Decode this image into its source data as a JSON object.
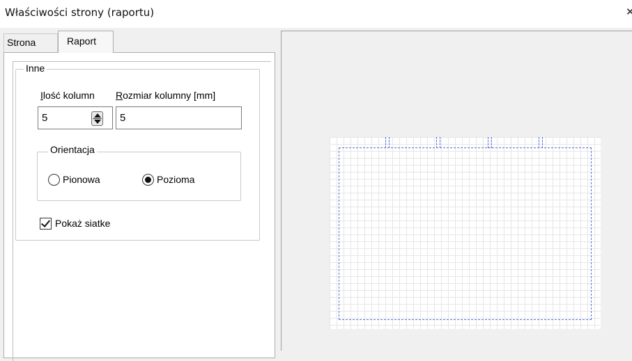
{
  "window": {
    "title": "Właściwości strony (raportu)",
    "close_glyph": "✕"
  },
  "tabs": [
    {
      "label": "Strona",
      "active": false
    },
    {
      "label": "Raport",
      "active": true
    }
  ],
  "inne": {
    "legend": "Inne",
    "columns_count": {
      "label_accel": "I",
      "label_rest": "lość kolumn",
      "value": "5",
      "spinner_icon": "spinner-up-down-icon"
    },
    "column_size": {
      "label_accel": "R",
      "label_rest": "ozmiar kolumny [mm]",
      "value": "5"
    },
    "orientation": {
      "legend": "Orientacja",
      "options": [
        {
          "label": "Pionowa",
          "selected": false
        },
        {
          "label": "Pozioma",
          "selected": true
        }
      ]
    },
    "show_grid": {
      "label": "Pokaż siatke",
      "checked": true
    }
  },
  "preview": {
    "orientation": "landscape",
    "columns": 5,
    "frame_color": "#5b6fd6"
  }
}
